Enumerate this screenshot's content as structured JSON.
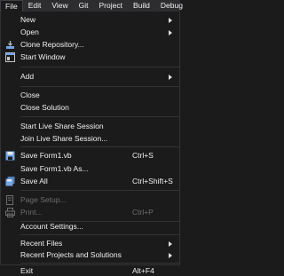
{
  "menubar": {
    "items": [
      "File",
      "Edit",
      "View",
      "Git",
      "Project",
      "Build",
      "Debug"
    ]
  },
  "file_menu": {
    "new": "New",
    "open": "Open",
    "clone": "Clone Repository...",
    "start_window": "Start Window",
    "add": "Add",
    "close": "Close",
    "close_solution": "Close Solution",
    "start_live_share": "Start Live Share Session",
    "join_live_share": "Join Live Share Session...",
    "save_form": "Save Form1.vb",
    "save_form_shortcut": "Ctrl+S",
    "save_form_as": "Save Form1.vb As...",
    "save_all": "Save All",
    "save_all_shortcut": "Ctrl+Shift+S",
    "page_setup": "Page Setup...",
    "print": "Print...",
    "print_shortcut": "Ctrl+P",
    "account_settings": "Account Settings...",
    "recent_files": "Recent Files",
    "recent_projects": "Recent Projects and Solutions",
    "exit": "Exit",
    "exit_shortcut": "Alt+F4"
  },
  "colors": {
    "menu_bg": "#1b1b1c",
    "menubar_bg": "#2d2d30",
    "icon_blue": "#75a5e3",
    "disabled_text": "#6d6d6d"
  }
}
